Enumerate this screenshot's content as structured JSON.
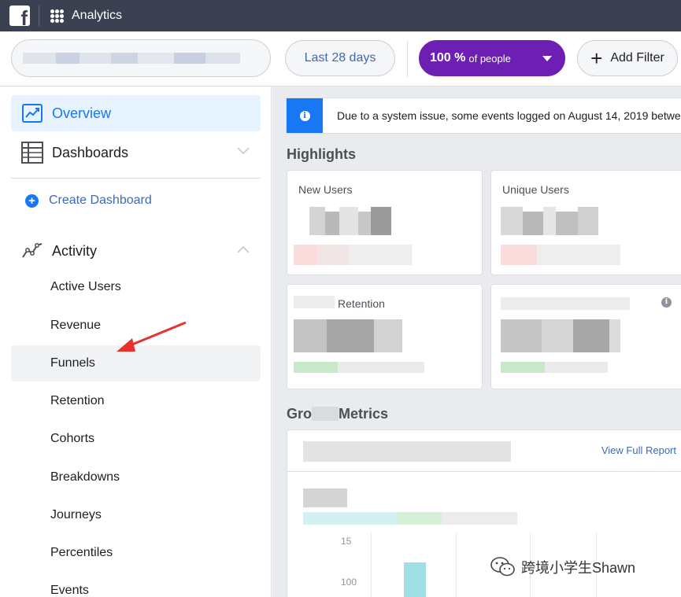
{
  "topbar": {
    "logo_letter": "f",
    "title": "Analytics"
  },
  "filters": {
    "date_range": "Last 28 days",
    "people_percent": "100 %",
    "people_suffix": "of people",
    "add_filter": "Add Filter"
  },
  "sidebar": {
    "overview": "Overview",
    "dashboards": "Dashboards",
    "create_dashboard": "Create Dashboard",
    "activity": "Activity",
    "activity_items": [
      "Active Users",
      "Revenue",
      "Funnels",
      "Retention",
      "Cohorts",
      "Breakdowns",
      "Journeys",
      "Percentiles",
      "Events"
    ]
  },
  "main": {
    "notice": "Due to a system issue, some events logged on August 14, 2019 betwee",
    "highlights_title": "Highlights",
    "cards": {
      "new_users_label": "New Users",
      "unique_users_label": "Unique Users",
      "retention_label": "Retention"
    },
    "growth_title_part1": "Gro",
    "growth_title_part2": "Metrics",
    "view_full_report": "View Full Report",
    "tick_150": "15",
    "tick_100": "100"
  },
  "watermark": "跨境小学生Shawn",
  "colors": {
    "topbar": "#3b4151",
    "people_pill": "#6e1fb3",
    "accent_blue": "#1877f2",
    "link_blue": "#4267b2",
    "arrow_red": "#e8322c"
  }
}
